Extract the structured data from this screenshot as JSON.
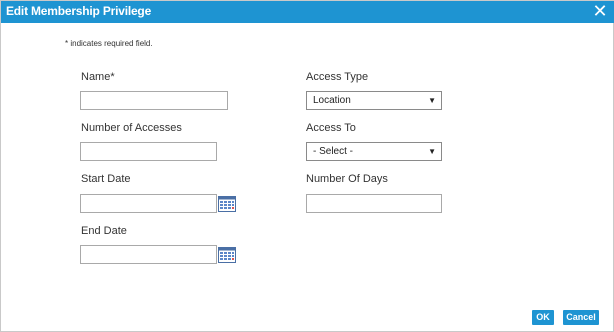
{
  "dialog": {
    "title": "Edit Membership Privilege",
    "close_icon": "close-icon"
  },
  "note": "* indicates required field.",
  "form": {
    "name_label": "Name*",
    "name_value": "",
    "accesses_label": "Number of Accesses",
    "accesses_value": "",
    "start_label": "Start Date",
    "start_value": "",
    "end_label": "End Date",
    "end_value": "",
    "access_type_label": "Access Type",
    "access_type_value": "Location",
    "access_to_label": "Access To",
    "access_to_value": "- Select -",
    "days_label": "Number Of Days",
    "days_value": ""
  },
  "buttons": {
    "ok": "OK",
    "cancel": "Cancel"
  },
  "colors": {
    "accent": "#1e94d2"
  },
  "icons": {
    "calendar": "calendar-icon",
    "dropdown": "chevron-down-icon"
  }
}
